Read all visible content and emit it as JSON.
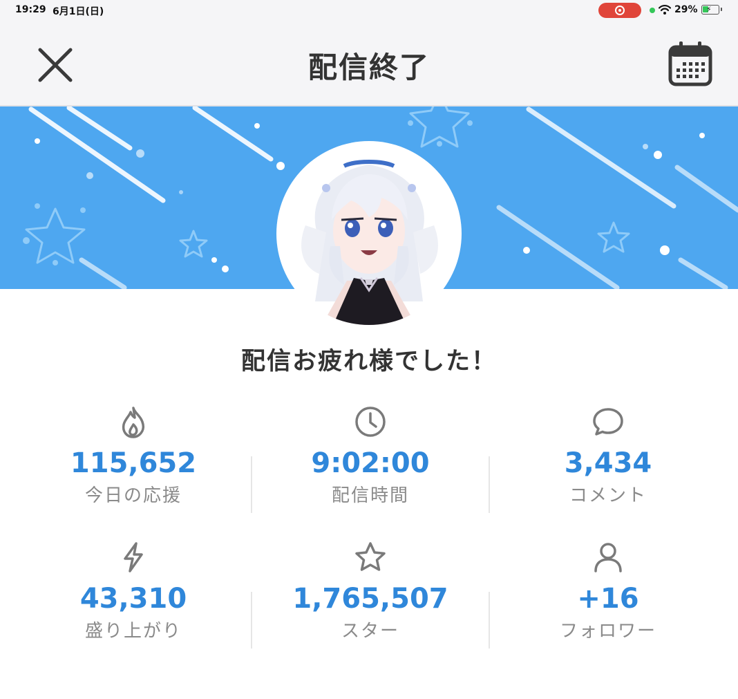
{
  "status_bar": {
    "time": "19:29",
    "date": "6月1日(日)",
    "battery": "29%"
  },
  "header": {
    "title": "配信終了"
  },
  "message": "配信お疲れ様でした！",
  "stats": [
    {
      "icon": "flame-icon",
      "value": "115,652",
      "label": "今日の応援"
    },
    {
      "icon": "clock-icon",
      "value": "9:02:00",
      "label": "配信時間"
    },
    {
      "icon": "comment-icon",
      "value": "3,434",
      "label": "コメント"
    },
    {
      "icon": "lightning-icon",
      "value": "43,310",
      "label": "盛り上がり"
    },
    {
      "icon": "star-icon",
      "value": "1,765,507",
      "label": "スター"
    },
    {
      "icon": "person-icon",
      "value": "+16",
      "label": "フォロワー"
    }
  ],
  "colors": {
    "accent": "#2f87da",
    "banner": "#4ea7f0",
    "label": "#8a8a8a",
    "recording": "#e0453a"
  }
}
